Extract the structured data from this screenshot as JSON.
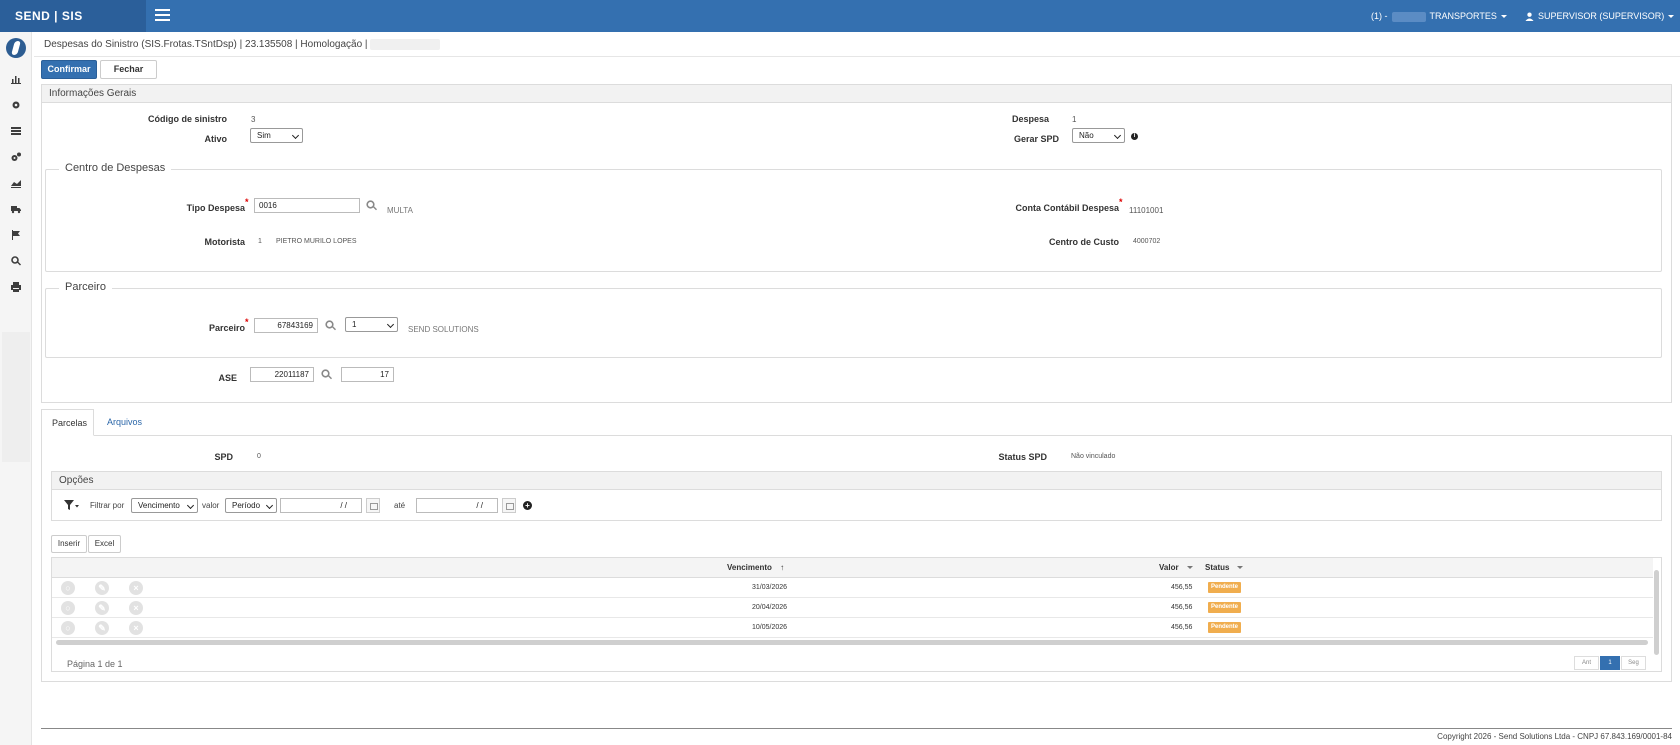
{
  "topbar": {
    "brand": "SEND | SIS",
    "company_prefix": "(1) -",
    "company": "TRANSPORTES",
    "user": "SUPERVISOR (SUPERVISOR)"
  },
  "sidebar_icons": [
    "chart-icon",
    "gear-icon",
    "list-icon",
    "gears-icon",
    "area-chart-icon",
    "truck-icon",
    "flag-icon",
    "search-icon",
    "print-icon"
  ],
  "breadcrumb": "Despesas do Sinistro (SIS.Frotas.TSntDsp) | 23.135508 | Homologação |",
  "toolbar": {
    "confirm": "Confirmar",
    "close": "Fechar"
  },
  "info": {
    "title": "Informações Gerais",
    "codigo_label": "Código de sinistro",
    "codigo_value": "3",
    "ativo_label": "Ativo",
    "ativo_value": "Sim",
    "despesa_label": "Despesa",
    "despesa_value": "1",
    "gerar_spd_label": "Gerar SPD",
    "gerar_spd_value": "Não",
    "info_icon": "i"
  },
  "centro": {
    "title": "Centro de Despesas",
    "tipo_label": "Tipo Despesa",
    "tipo_value": "0016",
    "tipo_desc": "MULTA",
    "conta_label": "Conta Contábil Despesa",
    "conta_value": "11101001",
    "motorista_label": "Motorista",
    "motorista_code": "1",
    "motorista_name": "PIETRO MURILO LOPES",
    "centro_custo_label": "Centro de Custo",
    "centro_custo_value": "4000702"
  },
  "parceiro": {
    "title": "Parceiro",
    "label": "Parceiro",
    "code": "67843169",
    "select": "1",
    "name": "SEND SOLUTIONS"
  },
  "ase": {
    "label": "ASE",
    "value1": "22011187",
    "value2": "17"
  },
  "tabs": [
    {
      "label": "Parcelas"
    },
    {
      "label": "Arquivos"
    }
  ],
  "parcelas": {
    "spd_label": "SPD",
    "spd_value": "0",
    "status_spd_label": "Status SPD",
    "status_spd_value": "Não vinculado"
  },
  "opcoes": {
    "title": "Opções",
    "filtrar_label": "Filtrar por",
    "filtrar_select": "Vencimento",
    "valor_label": "valor",
    "valor_select": "Período",
    "date_from": "/ /",
    "ate_label": "até",
    "date_to": "/ /"
  },
  "grid": {
    "insert": "Inserir",
    "excel": "Excel",
    "col_vencimento": "Vencimento",
    "col_valor": "Valor",
    "col_status": "Status",
    "rows": [
      {
        "vencimento": "31/03/2026",
        "valor": "456,55",
        "status": "Pendente"
      },
      {
        "vencimento": "20/04/2026",
        "valor": "456,56",
        "status": "Pendente"
      },
      {
        "vencimento": "10/05/2026",
        "valor": "456,56",
        "status": "Pendente"
      }
    ],
    "page_info": "Página 1 de 1",
    "prev": "Ant",
    "page": "1",
    "next": "Seg"
  },
  "footer": "Copyright 2026 - Send Solutions Ltda - CNPJ 67.843.169/0001-84",
  "colors": {
    "brand": "#3470b0",
    "badge": "#f0ad4e"
  }
}
